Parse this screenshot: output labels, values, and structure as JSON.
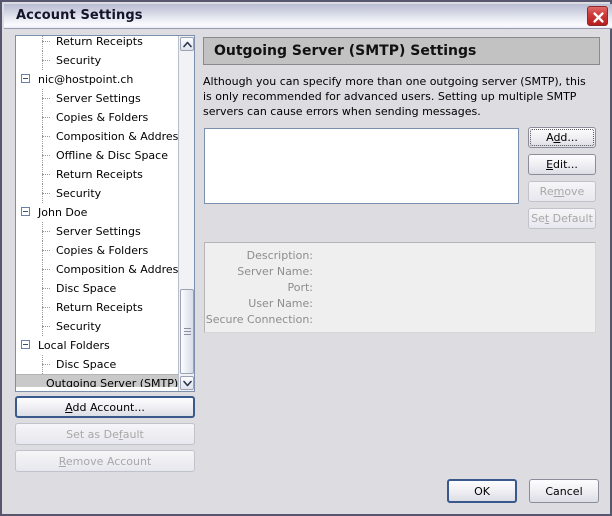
{
  "window": {
    "title": "Account Settings",
    "close_icon": "close-icon"
  },
  "sidebar": {
    "scroll": {
      "up_icon": "chevron-up-icon",
      "down_icon": "chevron-down-icon"
    },
    "tree": [
      {
        "label": "Return Receipts",
        "level": 1,
        "expander": false,
        "selected": false
      },
      {
        "label": "Security",
        "level": 1,
        "expander": false,
        "selected": false
      },
      {
        "label": "nic@hostpoint.ch",
        "level": 0,
        "expander": true,
        "selected": false
      },
      {
        "label": "Server Settings",
        "level": 1,
        "expander": false,
        "selected": false
      },
      {
        "label": "Copies & Folders",
        "level": 1,
        "expander": false,
        "selected": false
      },
      {
        "label": "Composition & Addressing",
        "level": 1,
        "expander": false,
        "selected": false
      },
      {
        "label": "Offline & Disc Space",
        "level": 1,
        "expander": false,
        "selected": false
      },
      {
        "label": "Return Receipts",
        "level": 1,
        "expander": false,
        "selected": false
      },
      {
        "label": "Security",
        "level": 1,
        "expander": false,
        "selected": false
      },
      {
        "label": "John Doe",
        "level": 0,
        "expander": true,
        "selected": false
      },
      {
        "label": "Server Settings",
        "level": 1,
        "expander": false,
        "selected": false
      },
      {
        "label": "Copies & Folders",
        "level": 1,
        "expander": false,
        "selected": false
      },
      {
        "label": "Composition & Addressing",
        "level": 1,
        "expander": false,
        "selected": false
      },
      {
        "label": "Disc Space",
        "level": 1,
        "expander": false,
        "selected": false
      },
      {
        "label": "Return Receipts",
        "level": 1,
        "expander": false,
        "selected": false
      },
      {
        "label": "Security",
        "level": 1,
        "expander": false,
        "selected": false
      },
      {
        "label": "Local Folders",
        "level": 0,
        "expander": true,
        "selected": false
      },
      {
        "label": "Disc Space",
        "level": 1,
        "expander": false,
        "selected": false
      },
      {
        "label": "Outgoing Server (SMTP)",
        "level": 1,
        "expander": false,
        "selected": true
      }
    ],
    "buttons": {
      "add_account": "Add Account...",
      "add_account_accel": "A",
      "set_as_default": "Set as Default",
      "set_as_default_accel": "f",
      "remove_account": "Remove Account",
      "remove_account_accel": "R"
    }
  },
  "main": {
    "header": "Outgoing Server (SMTP) Settings",
    "description": "Although you can specify more than one outgoing server (SMTP), this is only recommended for advanced users. Setting up multiple SMTP servers can cause errors when sending messages.",
    "server_list": [],
    "buttons": {
      "add": "Add...",
      "add_accel": "d",
      "edit": "Edit...",
      "edit_accel": "E",
      "remove": "Remove",
      "remove_accel": "m",
      "set_default": "Set Default",
      "set_default_accel": "t"
    },
    "details": [
      {
        "label": "Description:",
        "value": ""
      },
      {
        "label": "Server Name:",
        "value": ""
      },
      {
        "label": "Port:",
        "value": ""
      },
      {
        "label": "User Name:",
        "value": ""
      },
      {
        "label": "Secure Connection:",
        "value": ""
      }
    ]
  },
  "footer": {
    "ok": "OK",
    "cancel": "Cancel"
  }
}
